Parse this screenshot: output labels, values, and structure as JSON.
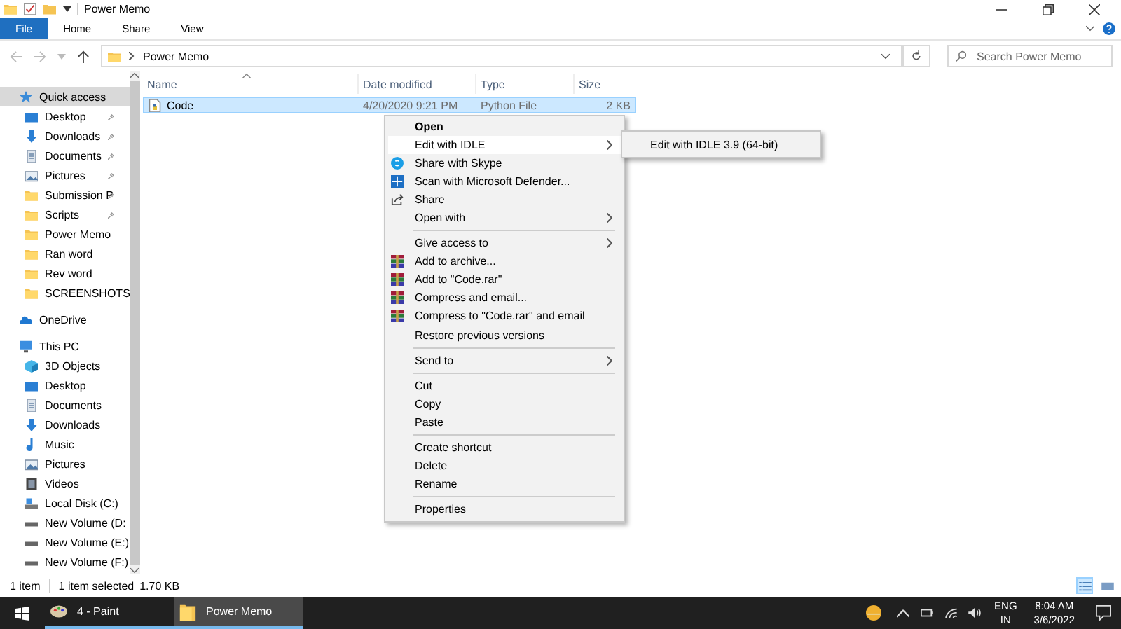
{
  "window": {
    "title": "Power Memo"
  },
  "ribbon_tabs": [
    {
      "label": "File",
      "selected": true
    },
    {
      "label": "Home",
      "selected": false
    },
    {
      "label": "Share",
      "selected": false
    },
    {
      "label": "View",
      "selected": false
    }
  ],
  "address": {
    "path": "Power Memo",
    "search_placeholder": "Search Power Memo"
  },
  "sidebar": {
    "items": [
      {
        "label": "Quick access",
        "kind": "star",
        "selected": true,
        "children": [
          {
            "label": "Desktop",
            "kind": "desktop",
            "pinned": true
          },
          {
            "label": "Downloads",
            "kind": "download",
            "pinned": true
          },
          {
            "label": "Documents",
            "kind": "document",
            "pinned": true
          },
          {
            "label": "Pictures",
            "kind": "picture",
            "pinned": true
          },
          {
            "label": "Submission P",
            "kind": "folder",
            "pinned": true
          },
          {
            "label": "Scripts",
            "kind": "folder",
            "pinned": true
          },
          {
            "label": "Power Memo",
            "kind": "folder",
            "pinned": false
          },
          {
            "label": "Ran word",
            "kind": "folder",
            "pinned": false
          },
          {
            "label": "Rev word",
            "kind": "folder",
            "pinned": false
          },
          {
            "label": "SCREENSHOTS",
            "kind": "folder",
            "pinned": false
          }
        ]
      },
      {
        "label": "OneDrive",
        "kind": "cloud",
        "selected": false
      },
      {
        "label": "This PC",
        "kind": "pc",
        "selected": false,
        "children": [
          {
            "label": "3D Objects",
            "kind": "cube",
            "pinned": false
          },
          {
            "label": "Desktop",
            "kind": "desktop",
            "pinned": false
          },
          {
            "label": "Documents",
            "kind": "document",
            "pinned": false
          },
          {
            "label": "Downloads",
            "kind": "download",
            "pinned": false
          },
          {
            "label": "Music",
            "kind": "music",
            "pinned": false
          },
          {
            "label": "Pictures",
            "kind": "picture",
            "pinned": false
          },
          {
            "label": "Videos",
            "kind": "video",
            "pinned": false
          },
          {
            "label": "Local Disk (C:)",
            "kind": "disk",
            "pinned": false
          },
          {
            "label": "New Volume (D:",
            "kind": "drive",
            "pinned": false
          },
          {
            "label": "New Volume (E:)",
            "kind": "drive",
            "pinned": false
          },
          {
            "label": "New Volume (F:)",
            "kind": "drive",
            "pinned": false
          }
        ]
      }
    ]
  },
  "table": {
    "columns": [
      "Name",
      "Date modified",
      "Type",
      "Size"
    ],
    "rows": [
      {
        "cells": [
          "Code",
          "4/20/2020 9:21 PM",
          "Python File",
          "2 KB"
        ],
        "selected": true
      }
    ]
  },
  "context_menu": {
    "items": [
      {
        "kind": "item",
        "label": "Open",
        "bold": true,
        "submenu": false,
        "selected": false
      },
      {
        "kind": "item",
        "label": "Edit with IDLE",
        "bold": false,
        "submenu": true,
        "selected": true
      },
      {
        "kind": "skype",
        "label": "Share with Skype",
        "bold": false,
        "submenu": false,
        "selected": false
      },
      {
        "kind": "defender",
        "label": "Scan with Microsoft Defender...",
        "bold": false,
        "submenu": false,
        "selected": false
      },
      {
        "kind": "share",
        "label": "Share",
        "bold": false,
        "submenu": false,
        "selected": false
      },
      {
        "kind": "item",
        "label": "Open with",
        "bold": false,
        "submenu": true,
        "selected": false
      },
      {
        "kind": "separator"
      },
      {
        "kind": "item",
        "label": "Give access to",
        "bold": false,
        "submenu": true,
        "selected": false
      },
      {
        "kind": "archive",
        "label": "Add to archive...",
        "bold": false,
        "submenu": false,
        "selected": false
      },
      {
        "kind": "archive",
        "label": "Add to \"Code.rar\"",
        "bold": false,
        "submenu": false,
        "selected": false
      },
      {
        "kind": "archive",
        "label": "Compress and email...",
        "bold": false,
        "submenu": false,
        "selected": false
      },
      {
        "kind": "archive",
        "label": "Compress to \"Code.rar\" and email",
        "bold": false,
        "submenu": false,
        "selected": false
      },
      {
        "kind": "item",
        "label": "Restore previous versions",
        "bold": false,
        "submenu": false,
        "selected": false
      },
      {
        "kind": "separator"
      },
      {
        "kind": "item",
        "label": "Send to",
        "bold": false,
        "submenu": true,
        "selected": false
      },
      {
        "kind": "separator"
      },
      {
        "kind": "item",
        "label": "Cut",
        "bold": false,
        "submenu": false,
        "selected": false
      },
      {
        "kind": "item",
        "label": "Copy",
        "bold": false,
        "submenu": false,
        "selected": false
      },
      {
        "kind": "item",
        "label": "Paste",
        "bold": false,
        "submenu": false,
        "selected": false
      },
      {
        "kind": "separator"
      },
      {
        "kind": "item",
        "label": "Create shortcut",
        "bold": false,
        "submenu": false,
        "selected": false
      },
      {
        "kind": "item",
        "label": "Delete",
        "bold": false,
        "submenu": false,
        "selected": false
      },
      {
        "kind": "item",
        "label": "Rename",
        "bold": false,
        "submenu": false,
        "selected": false
      },
      {
        "kind": "separator"
      },
      {
        "kind": "item",
        "label": "Properties",
        "bold": false,
        "submenu": false,
        "selected": false
      }
    ]
  },
  "submenu": {
    "items": [
      "Edit with IDLE 3.9 (64-bit)"
    ]
  },
  "status_bar": {
    "count": "1 item",
    "selection": "1 item selected",
    "size": "1.70 KB",
    "views": [
      {
        "kind": "details",
        "selected": true
      },
      {
        "kind": "icons",
        "selected": false
      }
    ]
  },
  "taskbar": {
    "apps": [
      {
        "label": "4 - Paint",
        "kind": "paint",
        "selected": false
      },
      {
        "label": "Power Memo",
        "kind": "folder",
        "selected": true
      }
    ],
    "language": "ENG",
    "region": "IN",
    "time": "8:04 AM",
    "date": "3/6/2022"
  }
}
